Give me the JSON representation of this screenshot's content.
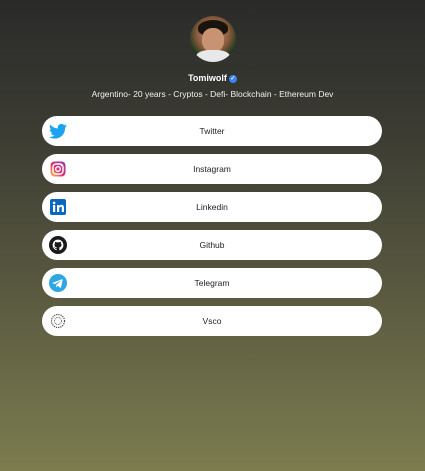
{
  "profile": {
    "name": "Tomiwolf",
    "bio": "Argentino- 20 years - Cryptos - Defi- Blockchain - Ethereum Dev"
  },
  "links": [
    {
      "label": "Twitter",
      "icon": "twitter-icon"
    },
    {
      "label": "Instagram",
      "icon": "instagram-icon"
    },
    {
      "label": "Linkedin",
      "icon": "linkedin-icon"
    },
    {
      "label": "Github",
      "icon": "github-icon"
    },
    {
      "label": "Telegram",
      "icon": "telegram-icon"
    },
    {
      "label": "Vsco",
      "icon": "vsco-icon"
    }
  ],
  "colors": {
    "background_top": "#2a2a2a",
    "background_bottom": "#7c7c4f",
    "twitter": "#1da1f2",
    "linkedin": "#0a66c2",
    "telegram": "#2ea6e0",
    "verified": "#3b82f6"
  }
}
